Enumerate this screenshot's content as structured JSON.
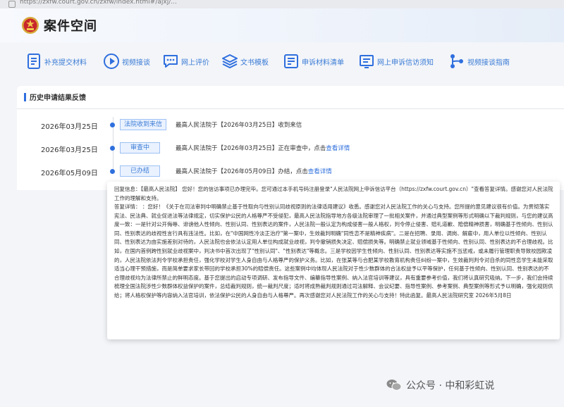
{
  "browser": {
    "url": "https://zxfw.court.gov.cn/zxfw/index.html#/ajxj/..."
  },
  "header": {
    "title": "案件空间"
  },
  "toolbar": [
    {
      "label": "补充提交材料",
      "icon": "document-upload-icon"
    },
    {
      "label": "视频接谈",
      "icon": "play-circle-icon"
    },
    {
      "label": "网上评价",
      "icon": "comment-icon"
    },
    {
      "label": "文书模板",
      "icon": "layers-icon"
    },
    {
      "label": "申诉材料清单",
      "icon": "list-document-icon"
    },
    {
      "label": "网上申诉信访须知",
      "icon": "notice-document-icon"
    },
    {
      "label": "视频接谈指南",
      "icon": "route-icon"
    }
  ],
  "history": {
    "title": "历史申请结果反馈",
    "rows": [
      {
        "date": "2026年03月25日",
        "status": "法院收到来信",
        "text": "最高人民法院于【2026年03月25日】收到来信",
        "link": ""
      },
      {
        "date": "2026年03月25日",
        "status": "审查中",
        "text": "最高人民法院于【2026年03月25日】正在审查中，点击",
        "link": "查看详情"
      },
      {
        "date": "2026年05月09日",
        "status": "已办结",
        "text": "最高人民法院于【2026年05月09日】办结，点击",
        "link": "查看详情"
      }
    ]
  },
  "reply": {
    "p1": "回复信息：【最高人民法院】         您好！您的信访事项已办理完毕。您可通过本手机号码注册登录\"人民法院网上申诉信访平台（https://zxfw.court.gov.cn）\"查看答复详情。感谢您对人民法院工作的理解和支持。",
    "p2": "答复详情：         ：您好！《关于在司法审判中明确禁止基于性取向与性别认同歧视原则的法律适用建议》收悉。感谢您对人民法院工作的关心与支持。您所提的意见建议很有价值。为贯彻落实宪法、民法典、就业促进法等法律规定，切实保护公民的人格尊严不受侵犯，最高人民法院指导地方各级法院审理了一批相关案件，并通过典型案例等形式明确以下裁判规则，与您的建议高度一致：一是针对公开侮辱、诽谤他人性倾向、性别认同、性别表达的案件，人民法院一般认定为构成侵害一般人格权，判令停止侵害、赔礼道歉、赔偿精神损害，明确基于性倾向、性别认同、性别表达的歧视性言行具有违法性。比如，在\"中国网性冷淡正治疗\"第一案中，生效裁判明确\"同性恋不是精神疾病\"。二是在招聘、录用、调岗、解雇中，用人单位以性倾向、性别认同、性别表达为由实施差别对待的，人民法院也会依法认定用人单位构成就业歧视，判令撤销损失决定、赔偿损失等。明确禁止就业领域基于性倾向、性别认同、性别表达的不合理歧视。比如，在国内首例跨性别就业歧视案中，判决书中首次出现了\"性别认同\"、\"性别表达\"等概念。三是学校因学生性倾向、性别认同、性别表达等实施不当惩戒，或未履行管理职责导致校园欺凌的，人民法院依法判令学校承担责任，强化学校对学生人身自由与人格尊严的保护义务。比如，在张某等与合肥某学校教育机构责任纠纷一案中，生效裁判判令对自杀的同性恋学生未能采取适当心理干预措施，而是简单要求家长带回的学校承担30%的赔偿责任。这些案例中均体现人民法院对于性少数群体的合法权益予以平等保护，任何基于性倾向、性别认同、性别表达的不合理歧视均为法律所禁止的鲜明态度。基于您提出的启动专项调研、发布指导文件、编纂指导性案例、纳入法官培训等建议，具有重要参考价值，我们将认真研究吸纳。下一步，我们会持续梳理全国法院涉性少数群体权益保护的案件，总结裁判规则，统一裁判尺度；适时将成熟裁判规则通过司法解释、会议纪要、指导性案例、参考案例、典型案例等形式予以明确，强化规则供给；将人格权保护等内容纳入法官培训，依法保护公民的人身自由与人格尊严。再次感谢您对人民法院工作的关心与支持！特此函复。最高人民法院研究室 2026年5月8日"
  },
  "watermark": {
    "text": "公众号 · 中和彩虹说"
  },
  "colors": {
    "accent": "#2f6fde",
    "tag_bg": "#eaf2ff"
  }
}
